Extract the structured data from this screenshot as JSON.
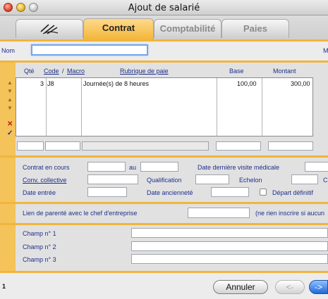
{
  "window": {
    "title": "Ajout de salarié"
  },
  "tabs": [
    {
      "label": "",
      "icon": "signature-icon"
    },
    {
      "label": "Contrat"
    },
    {
      "label": "Comptabilité"
    },
    {
      "label": "Paies"
    }
  ],
  "header": {
    "nom_label": "Nom",
    "nom_value": "",
    "right_label": "M"
  },
  "table": {
    "headers": {
      "qte": "Qté",
      "code": "Code",
      "slash": "/",
      "macro": "Macro",
      "rubrique": "Rubrique de paie",
      "base": "Base",
      "montant": "Montant"
    },
    "rows": [
      {
        "qte": "3",
        "code": "J8",
        "rubrique": "Journée(s) de 8 heures",
        "base": "100,00",
        "montant": "300,00"
      }
    ]
  },
  "contract": {
    "contrat_en_cours": "Contrat en cours",
    "au": "au",
    "derniere_visite": "Date dernière visite médicale",
    "conv_collective": "Conv. collective",
    "qualification": "Qualification",
    "echelon": "Echelon",
    "date_entree": "Date entrée",
    "date_anciennete": "Date ancienneté",
    "depart_definitif": "Départ définitif",
    "c_letter": "C"
  },
  "parente": {
    "label": "Lien de parenté avec le chef d'entreprise",
    "note": "(ne rien inscrire si aucun"
  },
  "champs": {
    "champ1": "Champ n° 1",
    "champ2": "Champ n° 2",
    "champ3": "Champ n° 3"
  },
  "footer": {
    "counter": "1",
    "cancel": "Annuler",
    "prev": "<-",
    "next": "->"
  }
}
